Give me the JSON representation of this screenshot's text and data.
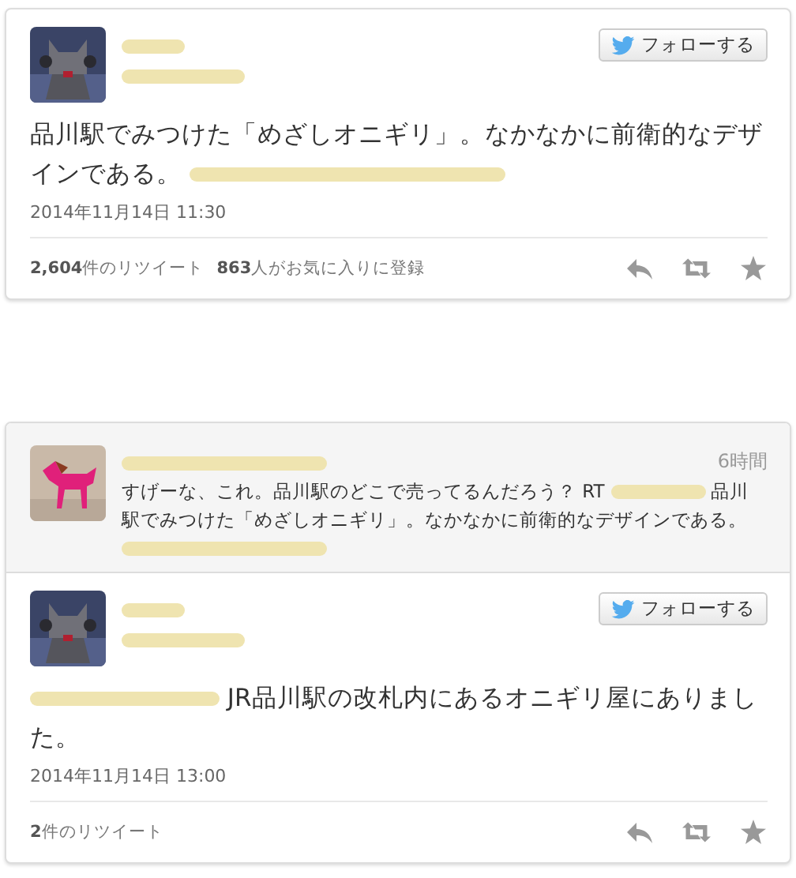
{
  "tweets": [
    {
      "author_name": [
        {
          "kind": "redacted"
        }
      ],
      "handle": [
        {
          "kind": "redacted"
        }
      ],
      "follow_button": "フォローする",
      "text": [
        {
          "kind": "text",
          "text": "品川駅でみつけた「めざしオニギリ」。なかなかに前衛的なデザインである。 "
        },
        {
          "kind": "redacted"
        }
      ],
      "date": "2014年11月14日 11:30",
      "stats": [
        "**2,604**件のリツイート",
        "**863**人がお気に入りに登録"
      ]
    },
    {
      "quoted": {
        "author_name": [
          {
            "kind": "redacted"
          }
        ],
        "time": "6時間",
        "text": [
          {
            "kind": "text",
            "text": "すげーな、これ。品川駅のどこで売ってるんだろう？ RT "
          },
          {
            "kind": "redacted"
          },
          {
            "kind": "text",
            "text": " 品川駅でみつけた「めざしオニギリ」。なかなかに前衛的なデザインである。 "
          },
          {
            "kind": "redacted"
          }
        ]
      },
      "author_name": [
        {
          "kind": "redacted"
        }
      ],
      "handle": [
        {
          "kind": "redacted"
        }
      ],
      "follow_button": "フォローする",
      "text": [
        {
          "kind": "redacted"
        },
        {
          "kind": "text",
          "text": " JR品川駅の改札内にあるオニギリ屋にありました。"
        }
      ],
      "date": "2014年11月14日 13:00",
      "stats": [
        "**2**件のリツイート"
      ]
    }
  ]
}
